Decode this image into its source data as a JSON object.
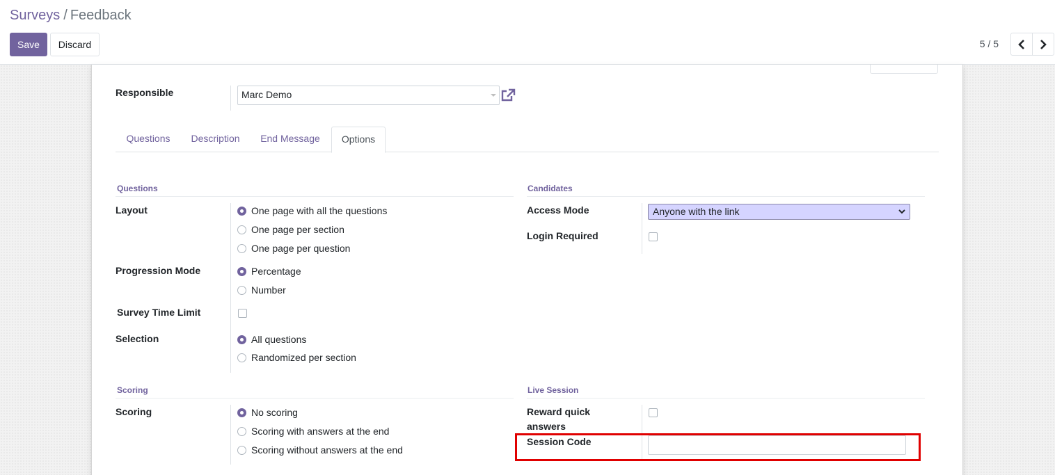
{
  "breadcrumb": {
    "parent": "Surveys",
    "separator": "/",
    "current": "Feedback"
  },
  "buttons": {
    "save": "Save",
    "discard": "Discard"
  },
  "pager": {
    "value": "5 / 5"
  },
  "responsible": {
    "label": "Responsible",
    "value": "Marc Demo"
  },
  "tabs": [
    {
      "label": "Questions"
    },
    {
      "label": "Description"
    },
    {
      "label": "End Message"
    },
    {
      "label": "Options",
      "active": true
    }
  ],
  "questions_section": {
    "title": "Questions",
    "layout": {
      "label": "Layout",
      "options": [
        "One page with all the questions",
        "One page per section",
        "One page per question"
      ],
      "selected": 0
    },
    "progression": {
      "label": "Progression Mode",
      "options": [
        "Percentage",
        "Number"
      ],
      "selected": 0
    },
    "time_limit": {
      "label": "Survey Time Limit",
      "checked": false
    },
    "selection": {
      "label": "Selection",
      "options": [
        "All questions",
        "Randomized per section"
      ],
      "selected": 0
    }
  },
  "candidates_section": {
    "title": "Candidates",
    "access_mode": {
      "label": "Access Mode",
      "value": "Anyone with the link"
    },
    "login_required": {
      "label": "Login Required",
      "checked": false
    }
  },
  "scoring_section": {
    "title": "Scoring",
    "scoring": {
      "label": "Scoring",
      "options": [
        "No scoring",
        "Scoring with answers at the end",
        "Scoring without answers at the end"
      ],
      "selected": 0
    }
  },
  "live_session_section": {
    "title": "Live Session",
    "reward_quick": {
      "label_line1": "Reward quick",
      "label_line2": "answers",
      "checked": false
    },
    "session_code": {
      "label": "Session Code",
      "value": ""
    }
  },
  "colors": {
    "brand": "#71639e",
    "highlight": "#e00000",
    "select_background": "#d5d4ff"
  }
}
